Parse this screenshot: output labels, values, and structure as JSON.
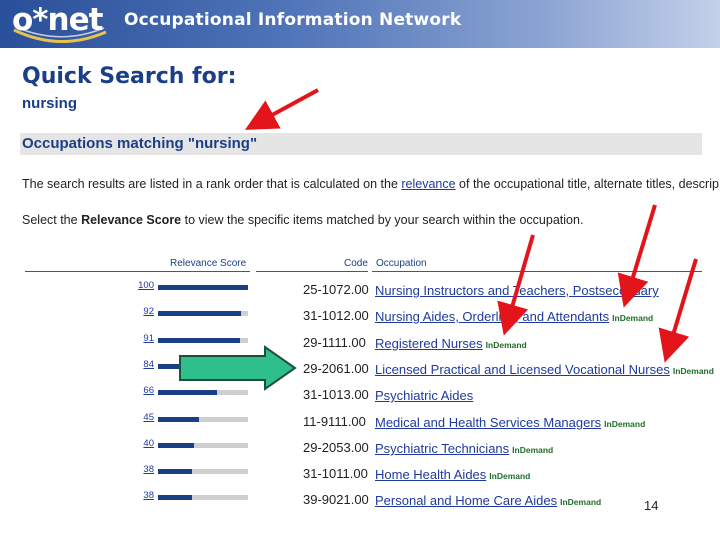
{
  "header": {
    "logo_text": "o*net",
    "title": "Occupational Information Network"
  },
  "quick_search": {
    "heading": "Quick Search for:",
    "term": "nursing"
  },
  "results_heading": "Occupations matching \"nursing\"",
  "paragraph1": {
    "before": "The search results are listed in a rank order that is calculated on the ",
    "link": "relevance",
    "after": " of the occupational title, alternate titles, descrip"
  },
  "paragraph2": {
    "before": "Select the ",
    "bold": "Relevance Score",
    "after": " to view the specific items matched by your search within the occupation."
  },
  "table": {
    "headers": {
      "relevance": "Relevance Score",
      "code": "Code",
      "occupation": "Occupation"
    },
    "rows": [
      {
        "score": "100",
        "relevance": 1.0,
        "code": "25-1072.00",
        "occupation": "Nursing Instructors and Teachers, Postsecondary",
        "badge": ""
      },
      {
        "score": "92",
        "relevance": 0.92,
        "code": "31-1012.00",
        "occupation": "Nursing Aides, Orderlies, and Attendants",
        "badge": "InDemand"
      },
      {
        "score": "91",
        "relevance": 0.91,
        "code": "29-1111.00",
        "occupation": "Registered Nurses",
        "badge": "InDemand"
      },
      {
        "score": "84",
        "relevance": 0.84,
        "code": "29-2061.00",
        "occupation": "Licensed Practical and Licensed Vocational Nurses",
        "badge": "InDemand"
      },
      {
        "score": "66",
        "relevance": 0.66,
        "code": "31-1013.00",
        "occupation": "Psychiatric Aides",
        "badge": ""
      },
      {
        "score": "45",
        "relevance": 0.45,
        "code": "11-9111.00",
        "occupation": "Medical and Health Services Managers",
        "badge": "InDemand"
      },
      {
        "score": "40",
        "relevance": 0.4,
        "code": "29-2053.00",
        "occupation": "Psychiatric Technicians",
        "badge": "InDemand"
      },
      {
        "score": "38",
        "relevance": 0.38,
        "code": "31-1011.00",
        "occupation": "Home Health Aides",
        "badge": "InDemand"
      },
      {
        "score": "38",
        "relevance": 0.38,
        "code": "39-9021.00",
        "occupation": "Personal and Home Care Aides",
        "badge": "InDemand"
      }
    ]
  },
  "slide_number": "14",
  "colors": {
    "navy": "#1a3f87",
    "link": "#1f3a9e",
    "arrow_red": "#e3151a",
    "arrow_green": "#2fbf8a",
    "badge_green": "#1f6e2a"
  }
}
